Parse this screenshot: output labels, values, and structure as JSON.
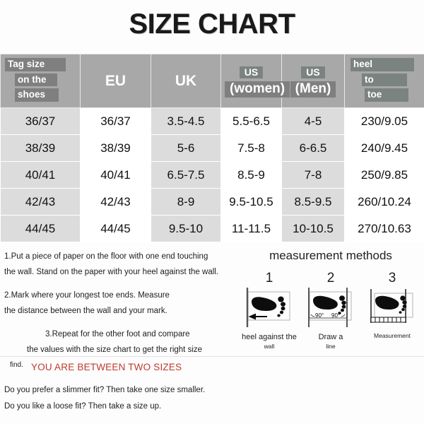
{
  "title": "SIZE CHART",
  "table": {
    "headers": [
      {
        "type": "stack",
        "lines": [
          "Tag size",
          "on the",
          "shoes"
        ]
      },
      {
        "type": "plain",
        "label": "EU"
      },
      {
        "type": "plain",
        "label": "UK"
      },
      {
        "type": "stack2",
        "lines": [
          "US",
          "(women)"
        ]
      },
      {
        "type": "stack2",
        "lines": [
          "US",
          "(Men)"
        ]
      },
      {
        "type": "stack_heel",
        "lines": [
          "heel",
          "to",
          "toe"
        ]
      }
    ],
    "rows": [
      [
        "36/37",
        "36/37",
        "3.5-4.5",
        "5.5-6.5",
        "4-5",
        "230/9.05"
      ],
      [
        "38/39",
        "38/39",
        "5-6",
        "7.5-8",
        "6-6.5",
        "240/9.45"
      ],
      [
        "40/41",
        "40/41",
        "6.5-7.5",
        "8.5-9",
        "7-8",
        "250/9.85"
      ],
      [
        "42/43",
        "42/43",
        "8-9",
        "9.5-10.5",
        "8.5-9.5",
        "260/10.24"
      ],
      [
        "44/45",
        "44/45",
        "9.5-10",
        "11-11.5",
        "10-10.5",
        "270/10.63"
      ]
    ]
  },
  "instructions": {
    "step1_line1": "1.Put a piece of paper on the floor with one end touching",
    "step1_line2": "the wall. Stand on the paper with your heel against the wall.",
    "step2_line1": "2.Mark where your longest toe ends. Measure",
    "step2_line2": "the distance between the wall and your mark.",
    "step3_line1": "3.Repeat for the other foot and compare",
    "step3_line2": "the values with the size chart to get the right size",
    "step3_line3": "find."
  },
  "methods": {
    "title": "measurement methods",
    "diagrams": [
      {
        "number": "1",
        "caption_line1": "heel against the",
        "caption_line2": "wall"
      },
      {
        "number": "2",
        "caption_line1": "Draw a",
        "caption_line2": "line",
        "angle_left": "90°",
        "angle_right": "90°"
      },
      {
        "number": "3",
        "caption_line1": "",
        "caption_line2": "Measurement"
      }
    ]
  },
  "bottom": {
    "between_sizes": "YOU ARE BETWEEN TWO SIZES",
    "fit_line1": "Do you prefer a slimmer fit? Then take one size smaller.",
    "fit_line2": "Do you like a loose fit? Then take a size up."
  },
  "colors": {
    "header_gray": "#a8a8a8",
    "highlight_gray": "#7f7f7f",
    "highlight_green_gray": "#7b8380",
    "row_shade": "#dcdcdc",
    "accent_red": "#c0392b",
    "text_dark": "#1a1a1a"
  }
}
